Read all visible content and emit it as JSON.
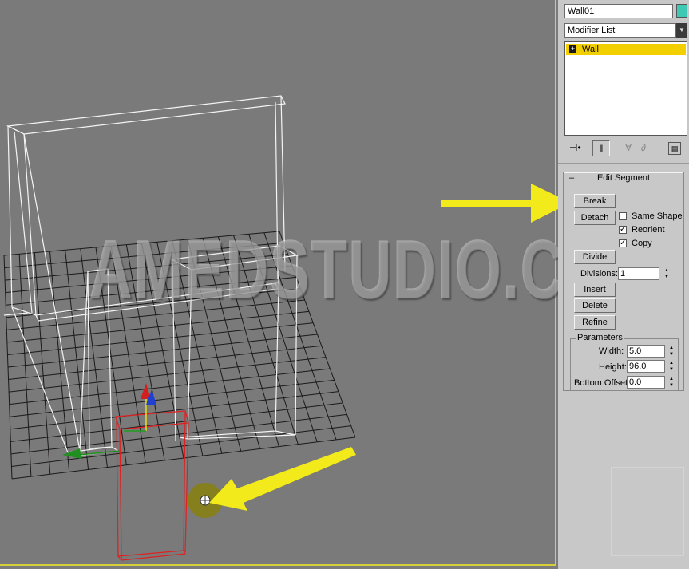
{
  "panel": {
    "object_name": "Wall01",
    "object_color": "#3fc8b4",
    "modifier_list_label": "Modifier List",
    "stack_items": [
      {
        "label": "Wall",
        "toggle": "+"
      }
    ],
    "stack_highlight_color": "#f2d000"
  },
  "edit_segment": {
    "title": "Edit Segment",
    "collapse_symbol": "–",
    "break_label": "Break",
    "detach_label": "Detach",
    "same_shape_label": "Same Shape",
    "same_shape_checked": false,
    "reorient_label": "Reorient",
    "reorient_checked": true,
    "copy_label": "Copy",
    "copy_checked": true,
    "divide_label": "Divide",
    "divisions_label": "Divisions:",
    "divisions_value": "1",
    "insert_label": "Insert",
    "delete_label": "Delete",
    "refine_label": "Refine"
  },
  "parameters": {
    "group_label": "Parameters",
    "width_label": "Width:",
    "width_value": "5.0",
    "height_label": "Height:",
    "height_value": "96.0",
    "bottom_offset_label": "Bottom Offset:",
    "bottom_offset_value": "0.0"
  },
  "watermark": "AMEDSTUDIO.COM",
  "icons": [
    "pin-stack-icon",
    "show-end-result-icon",
    "make-unique-icon",
    "remove-modifier-icon",
    "configure-modifier-sets-icon",
    "move-gizmo-icon",
    "cursor-icon",
    "arrow-icon"
  ],
  "colors": {
    "accent_yellow": "#f2ea1a",
    "selection_red": "#e02020",
    "wire_white": "#ffffff"
  }
}
